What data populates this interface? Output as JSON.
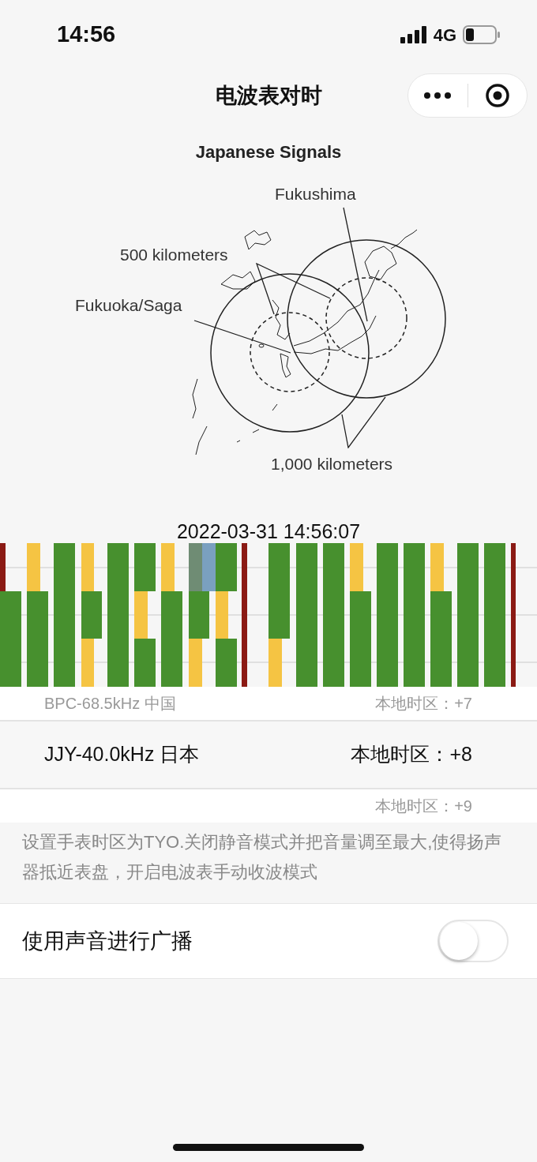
{
  "status_bar": {
    "time": "14:56",
    "network": "4G"
  },
  "nav_bar": {
    "title": "电波表对时"
  },
  "diagram": {
    "title": "Japanese Signals",
    "labels": [
      "Fukushima",
      "500 kilometers",
      "Fukuoka/Saga",
      "1,000 kilometers"
    ]
  },
  "timecode": {
    "timestamp": "2022-03-31 14:56:07"
  },
  "picker": {
    "rows": [
      {
        "station": "BPC-68.5kHz 中国",
        "timezone": "本地时区：+7",
        "selected": false
      },
      {
        "station": "JJY-40.0kHz 日本",
        "timezone": "本地时区：+8",
        "selected": true
      },
      {
        "timezone": "本地时区：+9",
        "selected": false
      }
    ]
  },
  "instructions": "设置手表时区为TYO.关闭静音模式并把音量调至最大,使得扬声器抵近表盘，开启电波表手动收波模式",
  "sound_broadcast": {
    "label": "使用声音进行广播",
    "on": false
  }
}
